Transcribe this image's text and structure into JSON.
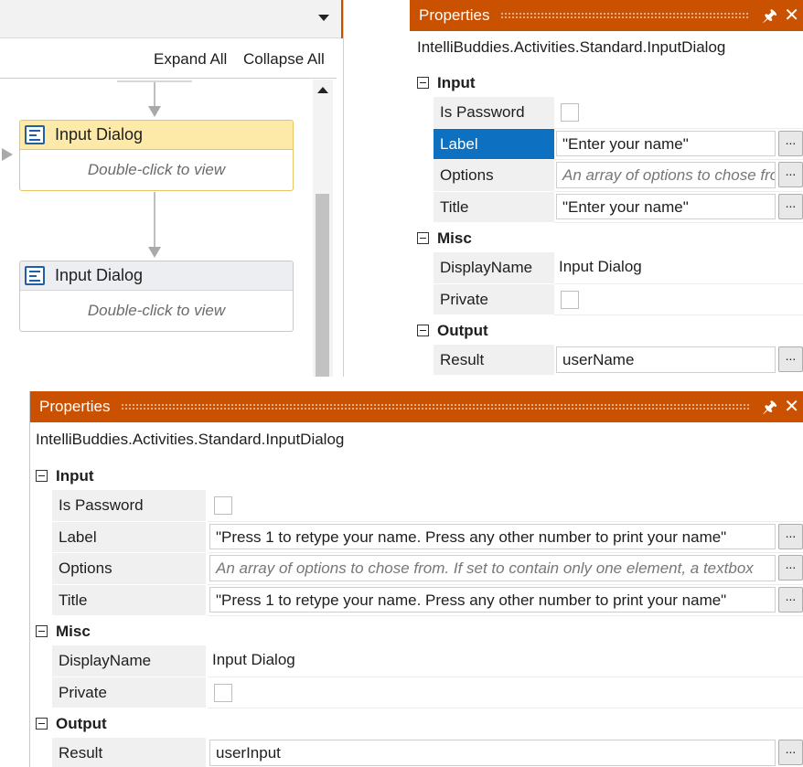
{
  "designer": {
    "toolbar": {
      "expand_all": "Expand All",
      "collapse_all": "Collapse All"
    },
    "activities": [
      {
        "title": "Input Dialog",
        "hint": "Double-click to view",
        "selected": true
      },
      {
        "title": "Input Dialog",
        "hint": "Double-click to view",
        "selected": false
      }
    ]
  },
  "panel_a": {
    "title": "Properties",
    "type_name": "IntelliBuddies.Activities.Standard.InputDialog",
    "categories": {
      "input": "Input",
      "misc": "Misc",
      "output": "Output"
    },
    "props": {
      "is_password": {
        "name": "Is Password",
        "checked": false
      },
      "label": {
        "name": "Label",
        "value": "\"Enter your name\""
      },
      "options": {
        "name": "Options",
        "placeholder": "An array of options to chose from. If set to contain only one element, a textbox"
      },
      "title": {
        "name": "Title",
        "value": "\"Enter your name\""
      },
      "display_name": {
        "name": "DisplayName",
        "value": "Input Dialog"
      },
      "private": {
        "name": "Private",
        "checked": false
      },
      "result": {
        "name": "Result",
        "value": "userName"
      }
    },
    "ellipsis": "..."
  },
  "panel_b": {
    "title": "Properties",
    "type_name": "IntelliBuddies.Activities.Standard.InputDialog",
    "categories": {
      "input": "Input",
      "misc": "Misc",
      "output": "Output"
    },
    "props": {
      "is_password": {
        "name": "Is Password",
        "checked": false
      },
      "label": {
        "name": "Label",
        "value": "\"Press 1 to retype your name. Press any other number to print your name\""
      },
      "options": {
        "name": "Options",
        "placeholder": "An array of options to chose from. If set to contain only one element, a textbox"
      },
      "title": {
        "name": "Title",
        "value": "\"Press 1 to retype your name. Press any other number to print your name\""
      },
      "display_name": {
        "name": "DisplayName",
        "value": "Input Dialog"
      },
      "private": {
        "name": "Private",
        "checked": false
      },
      "result": {
        "name": "Result",
        "value": "userInput"
      }
    },
    "ellipsis": "..."
  },
  "colors": {
    "titlebar": "#ca5100",
    "selected_row": "#0e70c0",
    "selected_activity": "#fde9a8"
  }
}
